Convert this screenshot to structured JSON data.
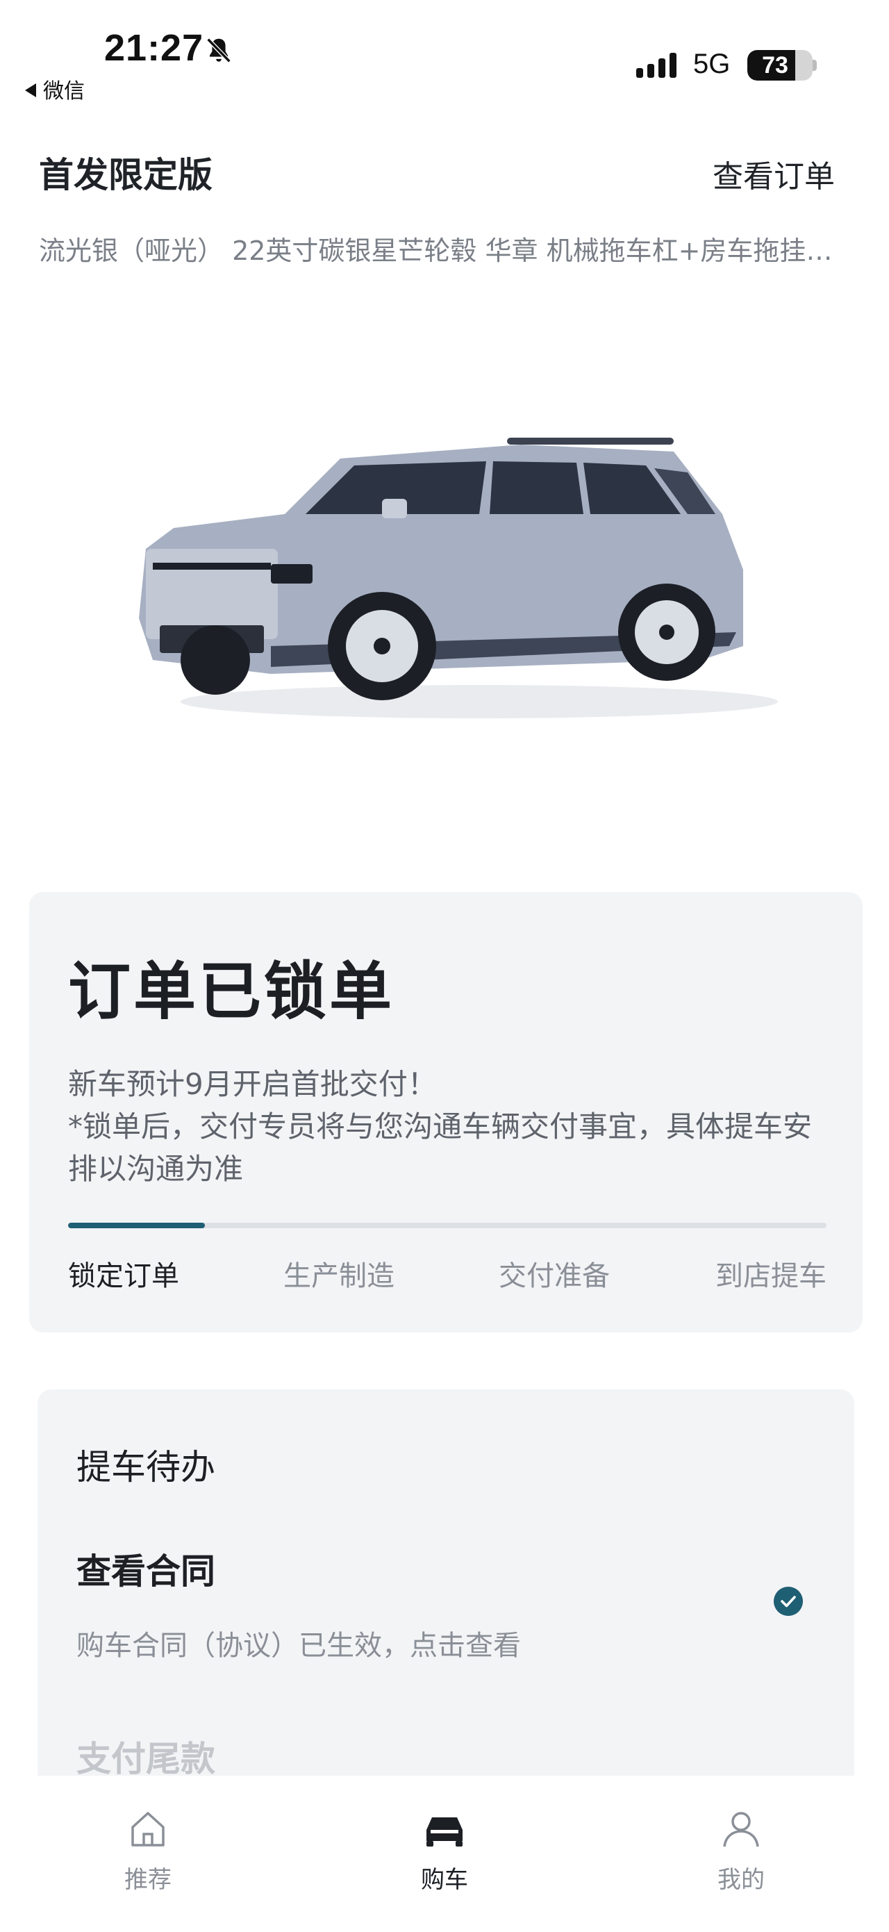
{
  "status_bar": {
    "time": "21:27",
    "back_label": "微信",
    "network": "5G",
    "battery_level": "73",
    "battery_fraction": 0.73,
    "icons": [
      "bell-muted-icon",
      "signal-icon",
      "battery-icon"
    ]
  },
  "header": {
    "title": "首发限定版",
    "view_order": "查看订单",
    "config": "流光银（哑光） 22英寸碳银星芒轮毂 华章 机械拖车杠+房车拖挂套件"
  },
  "order": {
    "status": "订单已锁单",
    "description_line1": "新车预计9月开启首批交付！",
    "description_line2": "*锁单后，交付专员将与您沟通车辆交付事宜，具体提车安排以沟通为准",
    "progress_fraction": 0.18,
    "steps": [
      "锁定订单",
      "生产制造",
      "交付准备",
      "到店提车"
    ],
    "active_step": 0,
    "accent_color": "#1f5f74"
  },
  "todo": {
    "title": "提车待办",
    "items": [
      {
        "name": "查看合同",
        "desc": "购车合同（协议）已生效，点击查看",
        "done": true
      },
      {
        "name": "支付尾款"
      }
    ]
  },
  "bottom_nav": {
    "items": [
      {
        "label": "推荐",
        "icon": "home-icon",
        "active": false
      },
      {
        "label": "购车",
        "icon": "car-icon",
        "active": true
      },
      {
        "label": "我的",
        "icon": "user-icon",
        "active": false
      }
    ]
  }
}
